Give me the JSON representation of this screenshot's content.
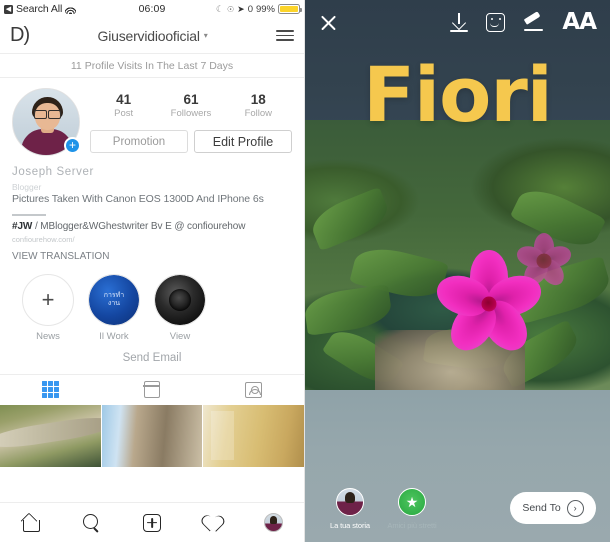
{
  "left_screen": {
    "status_bar": {
      "back_label": "Search All",
      "wifi_icon": "wifi-icon",
      "time": "06:09",
      "moon_icon": "moon-icon",
      "lock_icon": "lock-rotation-icon",
      "location_icon": "location-arrow-icon",
      "alarm": "0",
      "battery_percent": "99%",
      "battery_color": "#fcd42a"
    },
    "app_header": {
      "logo": "D)",
      "title": "Giuservidiooficial",
      "chevron": "▾",
      "menu_icon": "hamburger-menu-icon"
    },
    "visits_banner": "11 Profile Visits In The Last 7 Days",
    "avatar": {
      "name": "profile-avatar",
      "add_badge": "+"
    },
    "stats": [
      {
        "value": "41",
        "label": "Post"
      },
      {
        "value": "61",
        "label": "Followers"
      },
      {
        "value": "18",
        "label": "Follow"
      }
    ],
    "buttons": {
      "promotion": "Promotion",
      "edit_profile": "Edit Profile"
    },
    "bio": {
      "name": "Joseph Server",
      "category": "Blogger",
      "description": "Pictures Taken With Canon EOS 1300D And IPhone 6s",
      "tag_bold": "#JW",
      "tag_rest": "/ MBlogger&WGhestwriter Bv E @ confiourehow",
      "link": "confiourehow.com/",
      "view_translation": "VIEW TRANSLATION"
    },
    "highlights": [
      {
        "label": "News",
        "icon": "plus-icon"
      },
      {
        "label": "Il Work",
        "icon": "highlight-cover-blue"
      },
      {
        "label": "View",
        "icon": "highlight-cover-camera"
      }
    ],
    "send_email": "Send Email",
    "tabs": [
      {
        "name": "grid-tab",
        "icon": "grid-icon",
        "active": true
      },
      {
        "name": "igtv-tab",
        "icon": "tv-icon",
        "active": false
      },
      {
        "name": "tagged-tab",
        "icon": "tagged-person-icon",
        "active": false
      }
    ],
    "photo_grid": [
      {
        "name": "post-thumbnail-1"
      },
      {
        "name": "post-thumbnail-2"
      },
      {
        "name": "post-thumbnail-3"
      }
    ],
    "bottom_nav": [
      {
        "name": "home-icon"
      },
      {
        "name": "search-icon"
      },
      {
        "name": "add-post-icon"
      },
      {
        "name": "activity-heart-icon"
      },
      {
        "name": "profile-avatar-icon"
      }
    ]
  },
  "right_screen": {
    "top_icons": {
      "close": "close-icon",
      "download": "download-icon",
      "sticker": "sticker-icon",
      "draw": "draw-pen-icon",
      "text": "AA"
    },
    "story_text": "Fiori",
    "story_text_color": "#f5c84e",
    "actions": [
      {
        "label": "La tua storia",
        "icon": "your-story-avatar"
      },
      {
        "label": "Amici più stretti",
        "icon": "close-friends-star-icon"
      }
    ],
    "send_to": {
      "label": "Send To",
      "chevron": "›"
    }
  }
}
